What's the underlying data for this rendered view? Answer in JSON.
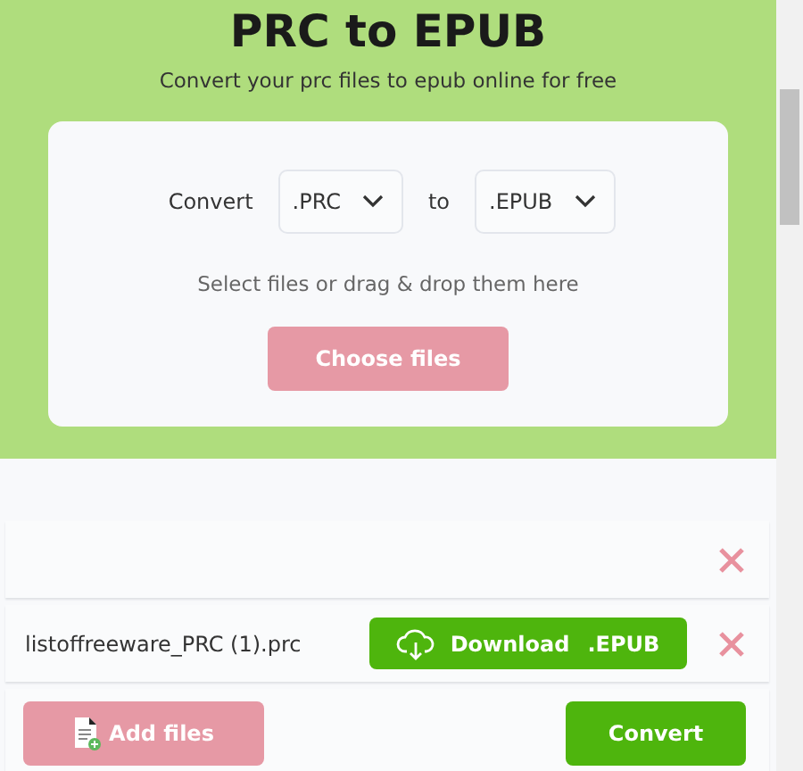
{
  "header": {
    "title": "PRC to EPUB",
    "subtitle": "Convert your prc files to epub online for free"
  },
  "converter": {
    "label_from": "Convert",
    "from_format": ".PRC",
    "label_to": "to",
    "to_format": ".EPUB",
    "hint": "Select files or drag & drop them here",
    "choose_button": "Choose files"
  },
  "files": [
    {
      "kind": "empty"
    },
    {
      "kind": "converted",
      "name": "listoffreeware_PRC (1).prc",
      "download_label": "Download",
      "download_format": ".EPUB"
    }
  ],
  "actions": {
    "add_button": "Add files",
    "convert_button": "Convert"
  }
}
